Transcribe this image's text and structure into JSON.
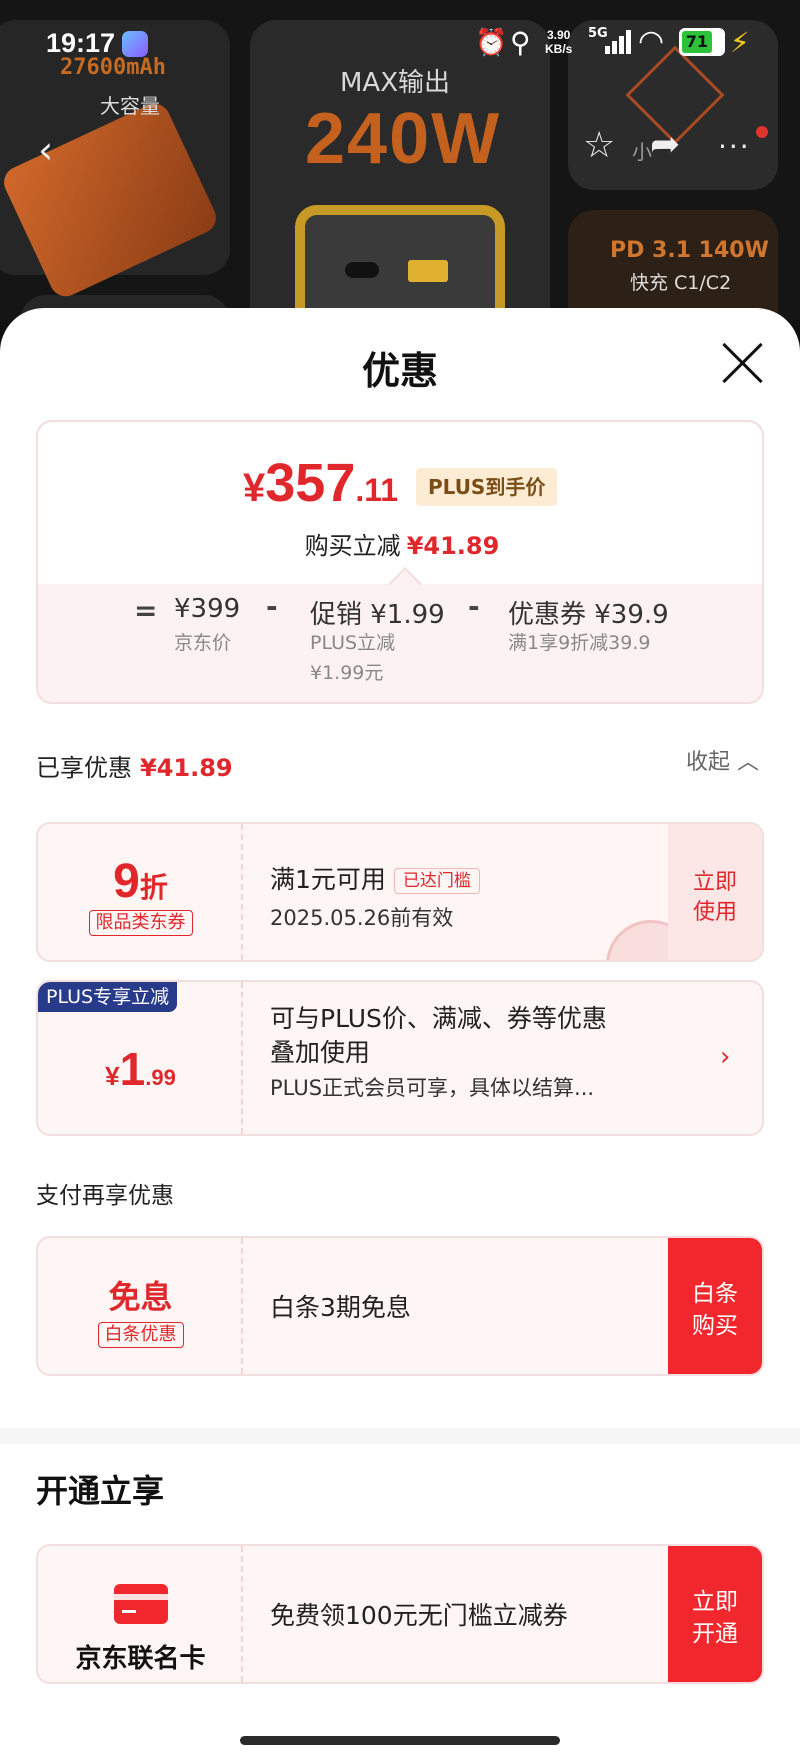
{
  "status_bar": {
    "time": "19:17",
    "net_speed_value": "3.90",
    "net_speed_unit": "KB/s",
    "network": "5G",
    "battery": "71"
  },
  "background": {
    "capacity": "27600mAh",
    "capacity_sub": "大容量",
    "max_output": "MAX输出",
    "watt": "240W",
    "pd": "PD 3.1 140W",
    "pd_sub": "快充 C1/C2",
    "small_text": "小"
  },
  "sheet": {
    "title": "优惠"
  },
  "price_card": {
    "yen": "¥",
    "int": "357",
    "dec": ".11",
    "tag": "PLUS到手价",
    "reduce_label": "购买立减",
    "reduce_amount": "¥41.89",
    "eq": "=",
    "minus": "-",
    "jd_price": "¥399",
    "jd_label": "京东价",
    "promo": "促销 ¥1.99",
    "promo_sub1": "PLUS立减",
    "promo_sub2": "¥1.99元",
    "coupon": "优惠券 ¥39.9",
    "coupon_sub": "满1享9折减39.9"
  },
  "enjoyed": {
    "label": "已享优惠",
    "amount": "¥41.89",
    "collapse": "收起 ︿"
  },
  "coupon1": {
    "value": "9",
    "unit": "折",
    "label": "限品类东券",
    "title": "满1元可用",
    "threshold": "已达门槛",
    "date": "2025.05.26前有效",
    "button": "立即\n使用"
  },
  "coupon2": {
    "badge": "PLUS专享立减",
    "yen": "¥",
    "int": "1",
    "dec": ".99",
    "title1": "可与PLUS价、满减、券等优惠",
    "title2": "叠加使用",
    "desc": "PLUS正式会员可享，具体以结算..."
  },
  "pay_section": {
    "label": "支付再享优惠"
  },
  "coupon3": {
    "value": "免息",
    "label": "白条优惠",
    "title": "白条3期免息",
    "button": "白条\n购买"
  },
  "open_section": {
    "title": "开通立享"
  },
  "coupon4": {
    "label": "京东联名卡",
    "title": "免费领100元无门槛立减券",
    "button": "立即\n开通"
  },
  "colors": {
    "accent_red": "#e0282c",
    "button_red": "#f0282e",
    "plus_blue": "#283a8a",
    "plus_gold_bg": "#fcecd3"
  },
  "icons": [
    "back-chevron-icon",
    "star-icon",
    "share-icon",
    "more-icon",
    "close-icon",
    "chevron-right-icon",
    "chevron-up-icon",
    "card-icon",
    "alarm-icon",
    "location-icon",
    "wifi-icon",
    "signal-icon",
    "battery-icon"
  ]
}
